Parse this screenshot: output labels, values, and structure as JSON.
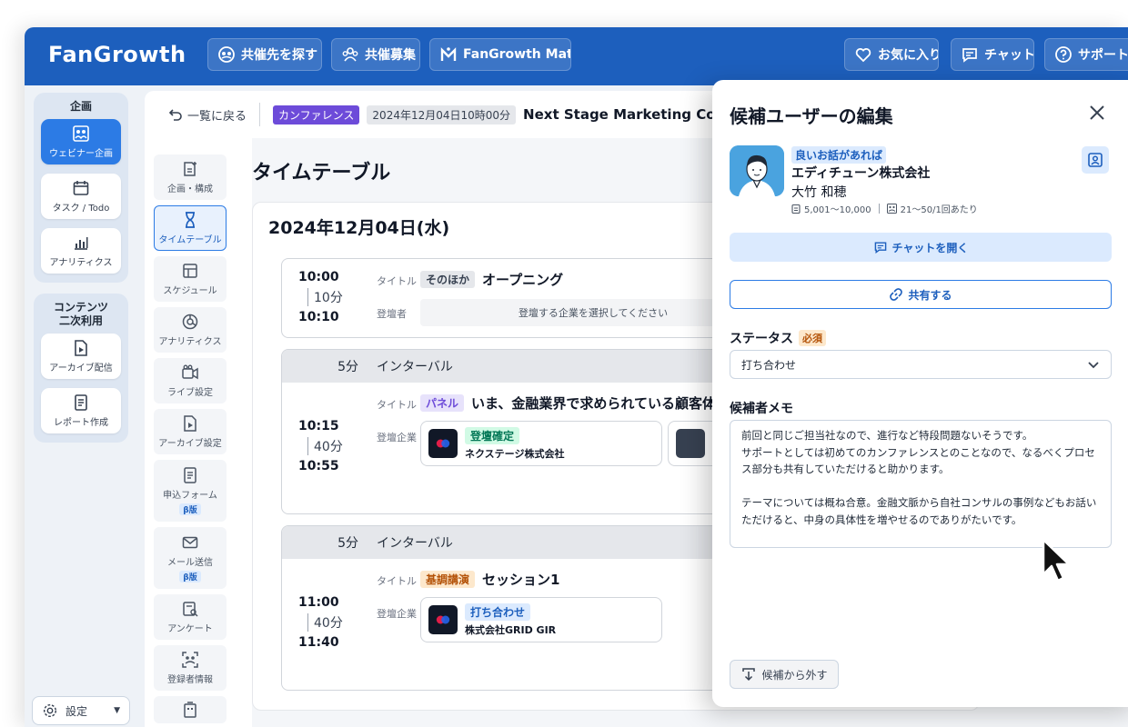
{
  "header": {
    "logo": "FanGrowth",
    "nav": [
      {
        "label": "共催先を探す",
        "icon": "handshake-icon"
      },
      {
        "label": "共催募集",
        "icon": "users-icon"
      },
      {
        "label": "FanGrowth Mate",
        "icon": "mate-logo-icon"
      }
    ],
    "right": [
      {
        "label": "お気に入り",
        "icon": "heart-icon"
      },
      {
        "label": "チャット",
        "icon": "chat-icon"
      },
      {
        "label": "サポートサイト",
        "icon": "help-icon"
      }
    ]
  },
  "leftnav": {
    "group1_title": "企画",
    "group1_items": [
      {
        "label": "ウェビナー企画",
        "icon": "webinar-icon",
        "active": true
      },
      {
        "label": "タスク / Todo",
        "icon": "calendar-icon",
        "active": false
      },
      {
        "label": "アナリティクス",
        "icon": "bar-chart-icon",
        "active": false
      }
    ],
    "group2_title_line1": "コンテンツ",
    "group2_title_line2": "二次利用",
    "group2_items": [
      {
        "label": "アーカイブ配信",
        "icon": "archive-icon"
      },
      {
        "label": "レポート作成",
        "icon": "report-icon"
      }
    ],
    "settings_label": "設定"
  },
  "breadcrumb": {
    "back_label": "一覧に戻る",
    "category": "カンファレンス",
    "datetime": "2024年12月04日10時00分",
    "event_title": "Next Stage Marketing Conference"
  },
  "subnav": [
    {
      "label": "企画・構成",
      "icon": "plan-icon",
      "active": false,
      "beta": ""
    },
    {
      "label": "タイムテーブル",
      "icon": "hourglass-icon",
      "active": true,
      "beta": ""
    },
    {
      "label": "スケジュール",
      "icon": "schedule-icon",
      "active": false,
      "beta": ""
    },
    {
      "label": "アナリティクス",
      "icon": "analytics-icon",
      "active": false,
      "beta": ""
    },
    {
      "label": "ライブ設定",
      "icon": "video-icon",
      "active": false,
      "beta": ""
    },
    {
      "label": "アーカイブ設定",
      "icon": "archive-file-icon",
      "active": false,
      "beta": ""
    },
    {
      "label": "申込フォーム",
      "icon": "form-icon",
      "active": false,
      "beta": "β版"
    },
    {
      "label": "メール送信",
      "icon": "mail-icon",
      "active": false,
      "beta": "β版"
    },
    {
      "label": "アンケート",
      "icon": "survey-icon",
      "active": false,
      "beta": ""
    },
    {
      "label": "登録者情報",
      "icon": "registrant-icon",
      "active": false,
      "beta": ""
    }
  ],
  "timetable": {
    "page_title": "タイムテーブル",
    "date_heading": "2024年12月04日(水)",
    "slot1": {
      "start": "10:00",
      "duration": "10分",
      "end": "10:10",
      "title_label": "タイトル",
      "kind": "そのほか",
      "title": "オープニング",
      "speaker_label": "登壇者",
      "speaker_placeholder": "登壇する企業を選択してください"
    },
    "interval1": {
      "duration": "5分",
      "label": "インターバル"
    },
    "slot2": {
      "start": "10:15",
      "duration": "40分",
      "end": "10:55",
      "title_label": "タイトル",
      "kind": "パネル",
      "title": "いま、金融業界で求められている顧客体験",
      "speaker_label": "登壇企業",
      "company_status": "登壇確定",
      "company_name": "ネクステージ株式会社"
    },
    "interval2": {
      "duration": "5分",
      "label": "インターバル"
    },
    "slot3": {
      "start": "11:00",
      "duration": "40分",
      "end": "11:40",
      "title_label": "タイトル",
      "kind": "基調講演",
      "title": "セッション1",
      "speaker_label": "登壇企業",
      "company_status": "打ち合わせ",
      "company_name": "株式会社GRID GIR"
    }
  },
  "drawer": {
    "title": "候補ユーザーの編集",
    "badge": "良いお話があれば",
    "company": "エディチューン株式会社",
    "person": "大竹 和穂",
    "employees": "5,001〜10,000",
    "attendance": "21〜50/1回あたり",
    "chat_button": "チャットを開く",
    "share_button": "共有する",
    "status_label": "ステータス",
    "required": "必須",
    "status_value": "打ち合わせ",
    "memo_label": "候補者メモ",
    "memo_text": "前回と同じご担当社なので、進行など特段問題ないそうです。\nサポートとしては初めてのカンファレンスとのことなので、なるべくプロセス部分も共有していただけると助かります。\n\nテーマについては概ね合意。金融文脈から自社コンサルの事例などもお話いただけると、中身の具体性を増やせるのでありがたいです。",
    "remove_button": "候補から外す"
  }
}
